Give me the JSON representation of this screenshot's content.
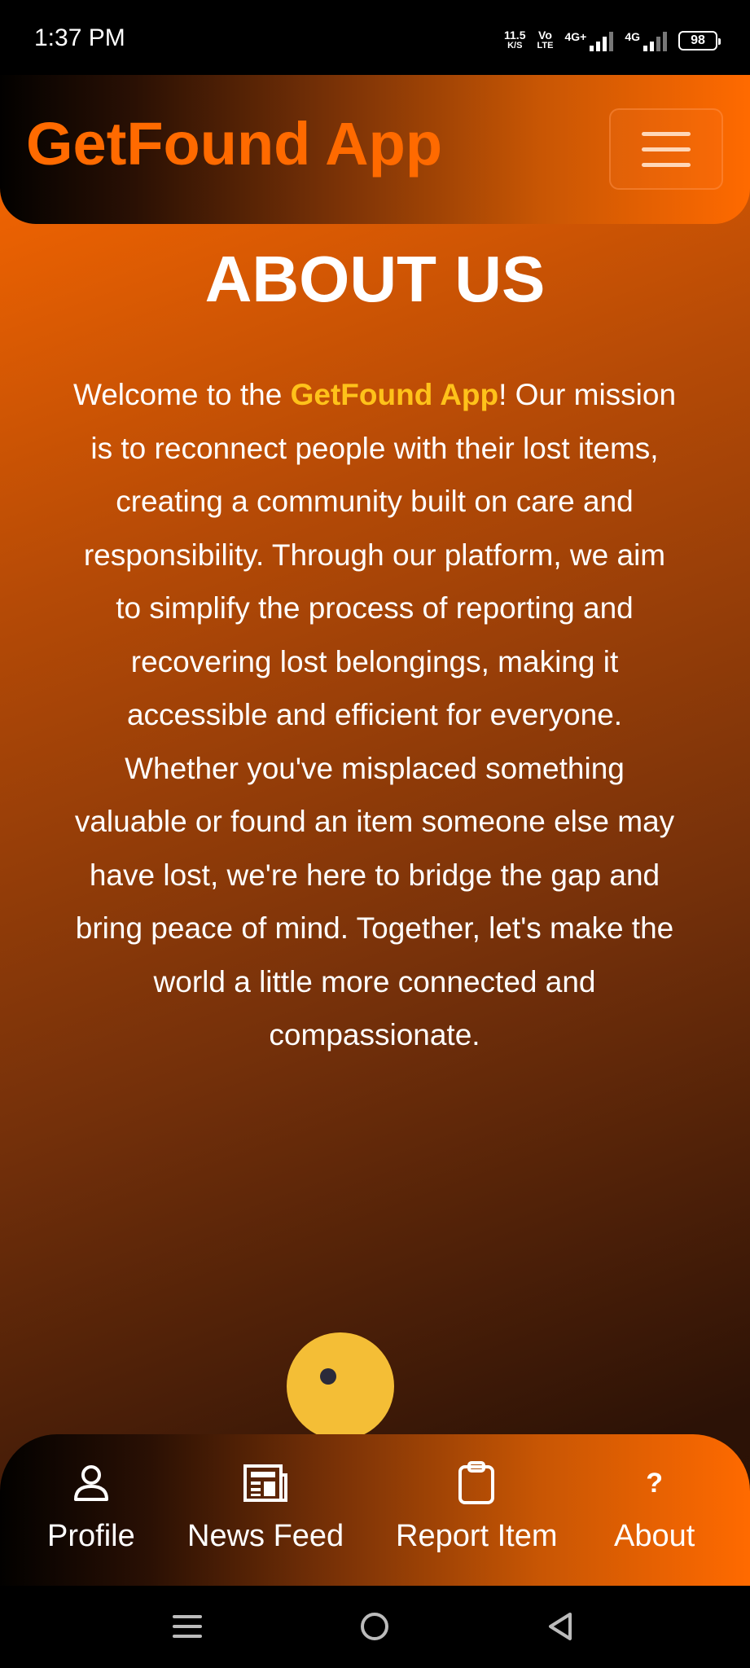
{
  "status_bar": {
    "time": "1:37 PM",
    "net_speed_value": "11.5",
    "net_speed_unit": "K/S",
    "volte_top": "Vo",
    "volte_bottom": "LTE",
    "sim1_label": "4G+",
    "sim2_label": "4G",
    "battery": "98"
  },
  "header": {
    "brand": "GetFound App",
    "menu_icon": "hamburger-icon"
  },
  "page": {
    "title": "ABOUT US",
    "intro_before": "Welcome to the ",
    "intro_highlight": "GetFound App",
    "intro_after": "! Our mission is to reconnect people with their lost items, creating a community built on care and responsibility. Through our platform, we aim to simplify the process of reporting and recovering lost belongings, making it accessible and efficient for everyone. Whether you've misplaced something valuable or found an item someone else may have lost, we're here to bridge the gap and bring peace of mind. Together, let's make the world a little more connected and compassionate."
  },
  "bottom_nav": {
    "items": [
      {
        "label": "Profile",
        "icon": "user-icon"
      },
      {
        "label": "News Feed",
        "icon": "newspaper-icon"
      },
      {
        "label": "Report Item",
        "icon": "clipboard-icon"
      },
      {
        "label": "About",
        "icon": "question-icon"
      }
    ]
  },
  "system_nav": {
    "icons": [
      "recents-icon",
      "home-icon",
      "back-icon"
    ]
  },
  "colors": {
    "brand_orange": "#ff6a00",
    "highlight_yellow": "#ffc21a",
    "dark_brown": "#2a1004"
  }
}
